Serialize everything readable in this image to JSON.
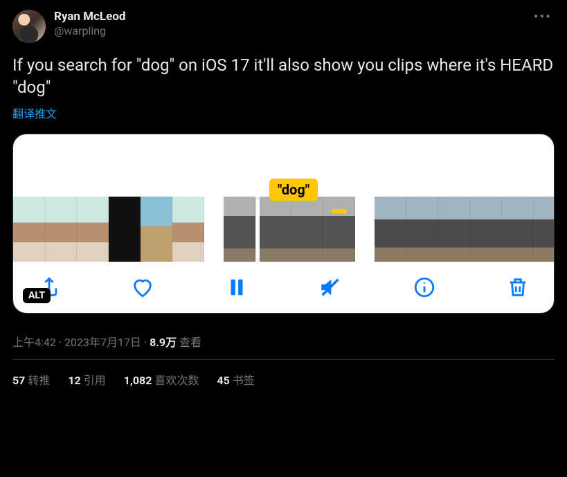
{
  "user": {
    "display_name": "Ryan McLeod",
    "handle": "@warpling"
  },
  "tweet_text": "If you search for \"dog\" on iOS 17 it'll also show you clips where it's HEARD \"dog\"",
  "translate_label": "翻译推文",
  "media": {
    "tooltip": "\"dog\"",
    "alt_label": "ALT",
    "toolbar": {
      "share": "share-icon",
      "like": "heart-icon",
      "pause": "pause-icon",
      "mute": "mute-icon",
      "info": "info-icon",
      "delete": "trash-icon"
    }
  },
  "meta": {
    "time": "上午4:42",
    "sep1": " · ",
    "date": "2023年7月17日",
    "sep2": " · ",
    "views_count": "8.9万",
    "views_label": " 查看"
  },
  "stats": {
    "retweets": {
      "count": "57",
      "label": "转推"
    },
    "quotes": {
      "count": "12",
      "label": "引用"
    },
    "likes": {
      "count": "1,082",
      "label": "喜欢次数"
    },
    "bookmarks": {
      "count": "45",
      "label": "书签"
    }
  }
}
